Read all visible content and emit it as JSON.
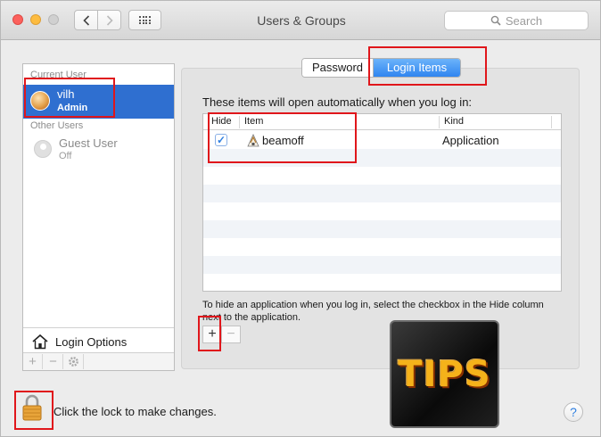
{
  "window": {
    "title": "Users & Groups",
    "search_placeholder": "Search"
  },
  "icons": {
    "back": "chevron-left-icon",
    "forward": "chevron-right-icon",
    "show_all": "grid-icon",
    "search": "magnifier-icon",
    "lock": "padlock-icon",
    "login_options": "house-icon"
  },
  "sidebar": {
    "current_user_header": "Current User",
    "current_user": {
      "name": "vilh",
      "role": "Admin"
    },
    "other_users_header": "Other Users",
    "guest": {
      "name": "Guest User",
      "status": "Off"
    },
    "login_options_label": "Login Options",
    "toolbar": {
      "add": "+",
      "remove": "−",
      "action": "gear"
    }
  },
  "tabs": [
    {
      "label": "Password",
      "selected": false
    },
    {
      "label": "Login Items",
      "selected": true
    }
  ],
  "login_items": {
    "intro": "These items will open automatically when you log in:",
    "columns": {
      "hide": "Hide",
      "item": "Item",
      "kind": "Kind"
    },
    "rows": [
      {
        "hide": true,
        "item": "beamoff",
        "kind": "Application"
      }
    ],
    "hint": "To hide an application when you log in, select the checkbox in the Hide column next to the application.",
    "add_label": "+",
    "remove_label": "−"
  },
  "footer": {
    "lock_text": "Click the lock to make changes.",
    "help_label": "?"
  },
  "overlay": {
    "tips_text": "TIPS"
  },
  "colors": {
    "accent": "#2f6fd0",
    "tab_selected": "#3a8cf2",
    "annotation_red": "#e0161b",
    "tips_gold": "#f5b21a"
  }
}
